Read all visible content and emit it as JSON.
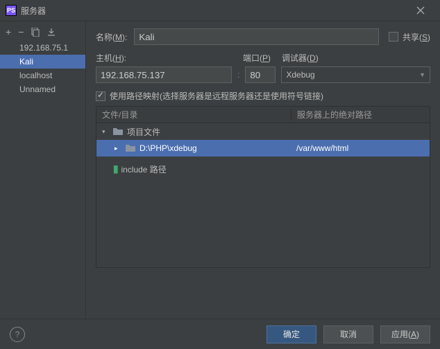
{
  "window": {
    "title": "服务器"
  },
  "sidebar": {
    "items": [
      {
        "label": "192.168.75.1"
      },
      {
        "label": "Kali"
      },
      {
        "label": "localhost"
      },
      {
        "label": "Unnamed"
      }
    ],
    "selectedIndex": 1
  },
  "form": {
    "nameLabel": "名称",
    "nameMnemonic": "M",
    "nameValue": "Kali",
    "shareLabel": "共享",
    "shareMnemonic": "S",
    "shareChecked": false,
    "hostLabel": "主机",
    "hostMnemonic": "H",
    "hostValue": "192.168.75.137",
    "portLabel": "端口",
    "portMnemonic": "P",
    "portValue": "80",
    "debuggerLabel": "调试器",
    "debuggerMnemonic": "D",
    "debuggerValue": "Xdebug",
    "mapChecked": true,
    "mapLabel": "使用路径映射(选择服务器是远程服务器还是使用符号链接)"
  },
  "tree": {
    "col1": "文件/目录",
    "col2": "服务器上的绝对路径",
    "rows": [
      {
        "kind": "folder",
        "expand": "down",
        "indent": 0,
        "label": "项目文件",
        "path": ""
      },
      {
        "kind": "folder",
        "expand": "right",
        "indent": 1,
        "label": "D:\\PHP\\xdebug",
        "path": "/var/www/html",
        "selected": true
      },
      {
        "kind": "include",
        "indent": 0,
        "label": "include 路径",
        "path": ""
      }
    ]
  },
  "buttons": {
    "ok": "确定",
    "cancel": "取消",
    "apply": "应用",
    "applyMnemonic": "A"
  }
}
